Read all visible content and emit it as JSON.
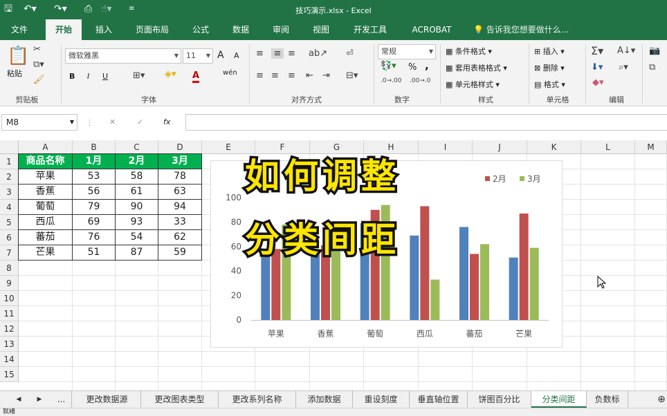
{
  "title": "技巧演示.xlsx - Excel",
  "tabs": [
    "文件",
    "开始",
    "插入",
    "页面布局",
    "公式",
    "数据",
    "审阅",
    "视图",
    "开发工具",
    "ACROBAT"
  ],
  "active_tab": "开始",
  "tell_me": "告诉我您想要做什么...",
  "ribbon": {
    "clipboard": {
      "label": "剪贴板",
      "paste": "粘贴"
    },
    "font": {
      "label": "字体",
      "name": "微软雅黑",
      "size": "11",
      "bold": "B",
      "italic": "I",
      "underline": "U",
      "grow": "A",
      "shrink": "A",
      "wen": "wén"
    },
    "alignment": {
      "label": "对齐方式"
    },
    "number": {
      "label": "数字",
      "format": "常规",
      "percent": "%",
      "comma": ","
    },
    "styles": {
      "label": "样式",
      "conditional": "条件格式",
      "table": "套用表格格式",
      "cell": "单元格样式"
    },
    "cells": {
      "label": "单元格",
      "insert": "插入",
      "delete": "删除",
      "format": "格式"
    },
    "editing": {
      "label": "编辑"
    }
  },
  "formula_bar": {
    "name_box": "M8",
    "cancel": "✕",
    "enter": "✓",
    "fx": "fx",
    "formula": ""
  },
  "columns": [
    "A",
    "B",
    "C",
    "D",
    "E",
    "F",
    "G",
    "H",
    "I",
    "J",
    "K",
    "L",
    "M"
  ],
  "rows": [
    "1",
    "2",
    "3",
    "4",
    "5",
    "6",
    "7",
    "8",
    "9",
    "10",
    "11",
    "12",
    "13",
    "14",
    "15"
  ],
  "table": {
    "headers": [
      "商品名称",
      "1月",
      "2月",
      "3月"
    ],
    "rows": [
      [
        "苹果",
        "53",
        "58",
        "78"
      ],
      [
        "香蕉",
        "56",
        "61",
        "63"
      ],
      [
        "葡萄",
        "79",
        "90",
        "94"
      ],
      [
        "西瓜",
        "69",
        "93",
        "33"
      ],
      [
        "蕃茄",
        "76",
        "54",
        "62"
      ],
      [
        "芒果",
        "51",
        "87",
        "59"
      ]
    ]
  },
  "overlay": {
    "line1": "如何调整",
    "line2": "分类间距"
  },
  "colors": {
    "excel_green": "#217346",
    "header_green": "#00b050",
    "series1": "#4f81bd",
    "series2": "#c0504d",
    "series3": "#9bbb59",
    "overlay_yellow": "#ffe600"
  },
  "chart_data": {
    "type": "bar",
    "categories": [
      "苹果",
      "香蕉",
      "葡萄",
      "西瓜",
      "蕃茄",
      "芒果"
    ],
    "series": [
      {
        "name": "1月",
        "values": [
          53,
          56,
          79,
          69,
          76,
          51
        ]
      },
      {
        "name": "2月",
        "values": [
          58,
          61,
          90,
          93,
          54,
          87
        ]
      },
      {
        "name": "3月",
        "values": [
          78,
          63,
          94,
          33,
          62,
          59
        ]
      }
    ],
    "legend_visible": [
      "2月",
      "3月"
    ],
    "yticks": [
      "0",
      "20",
      "40",
      "60",
      "80",
      "100"
    ],
    "ylim": [
      0,
      100
    ],
    "grid": false,
    "legend_position": "top-right"
  },
  "sheet_nav": {
    "prev": "◀",
    "next": "▶",
    "more": "..."
  },
  "sheets": [
    "更改数据源",
    "更改图表类型",
    "更改系列名称",
    "添加数据",
    "重设刻度",
    "垂直轴位置",
    "饼图百分比",
    "分类间距",
    "负数标"
  ],
  "active_sheet": "分类间距",
  "status": {
    "ready": "就绪"
  }
}
